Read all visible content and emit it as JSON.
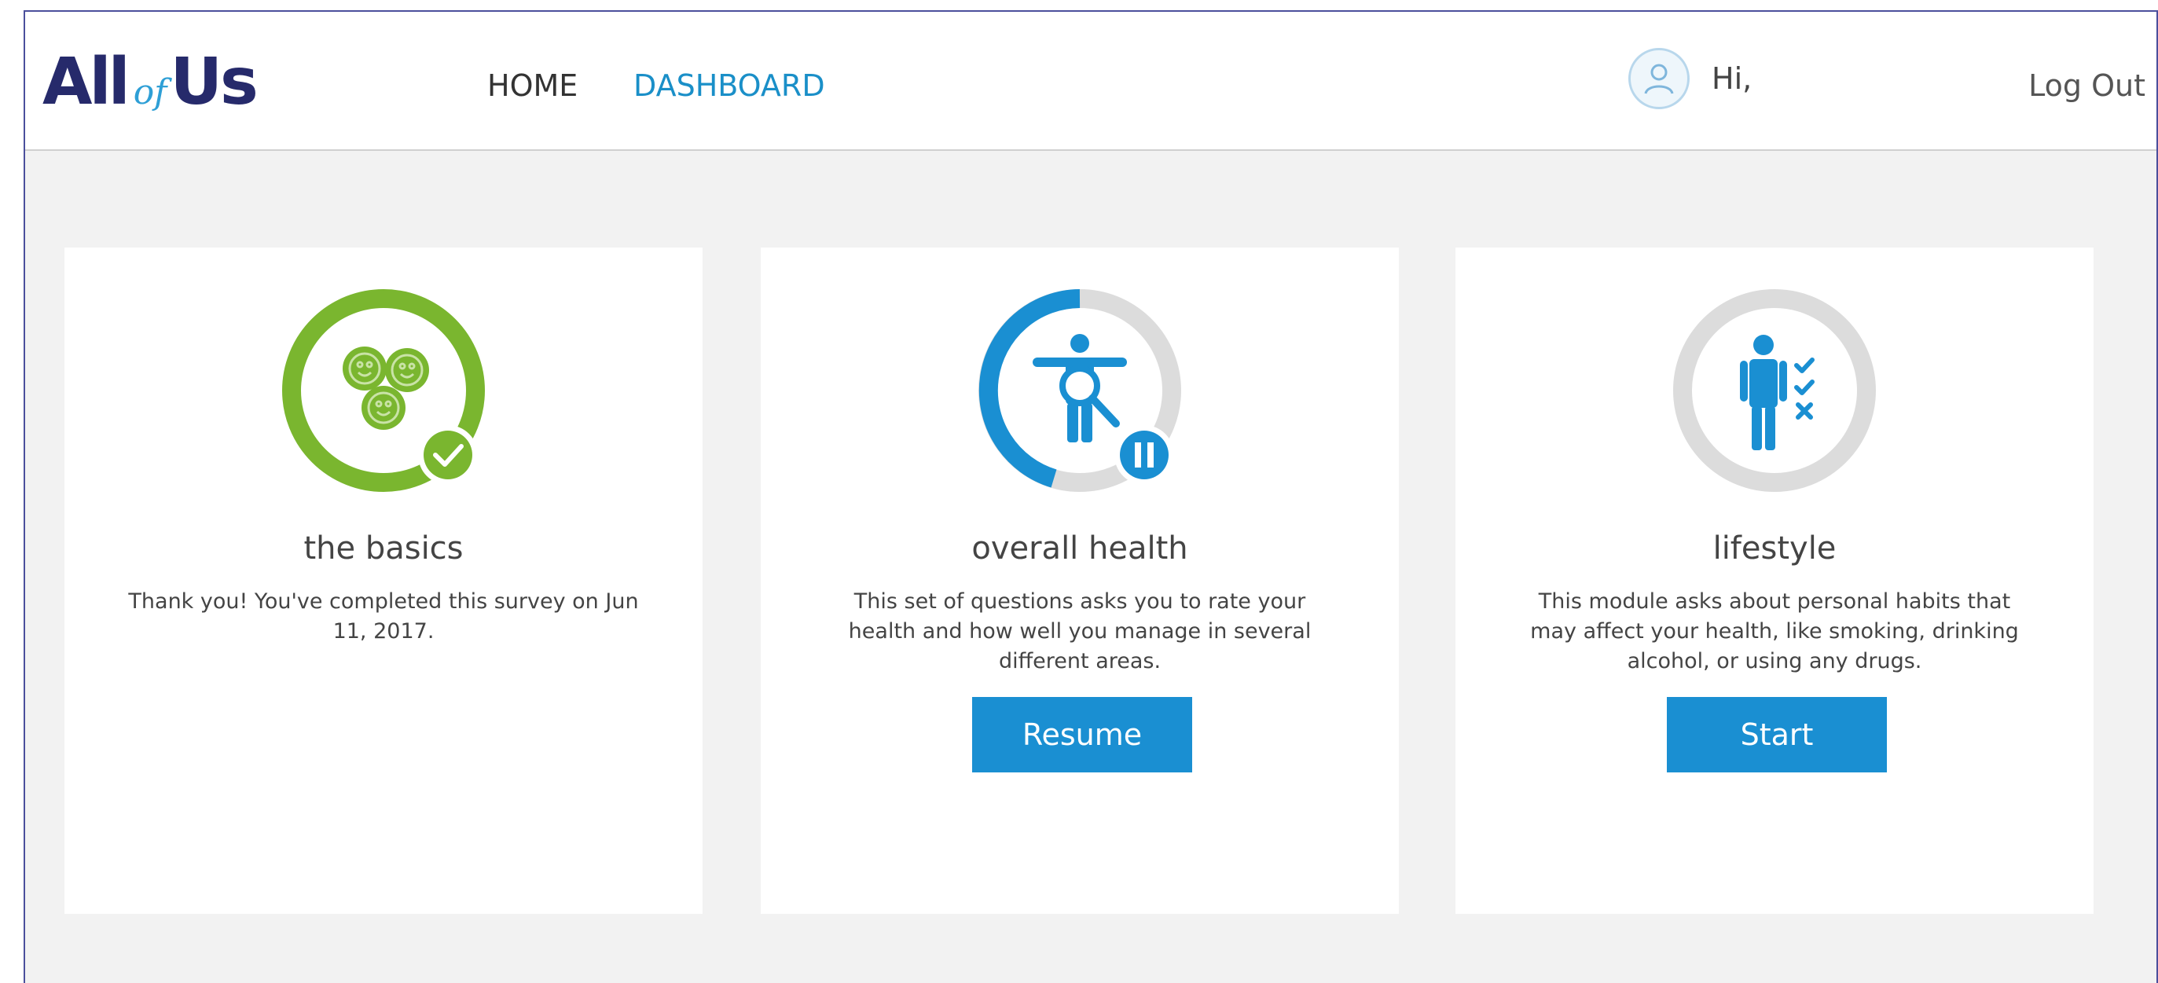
{
  "header": {
    "logo": {
      "part1": "All",
      "part2": "of",
      "part3": "Us"
    },
    "nav": {
      "home": "HOME",
      "dashboard": "DASHBOARD"
    },
    "greeting": "Hi,",
    "logout": "Log Out"
  },
  "colors": {
    "brand_navy": "#262a6b",
    "accent_blue": "#1a8fd2",
    "complete_green": "#7ab62f",
    "ring_gray": "#dcdcdc",
    "page_bg": "#f2f2f2"
  },
  "surveys": [
    {
      "title": "the basics",
      "description": "Thank you! You've completed this survey on Jun 11, 2017.",
      "status": "complete",
      "progress": 1.0,
      "icon": "smiley-faces-icon",
      "badge": "check-icon",
      "button": null
    },
    {
      "title": "overall health",
      "description": "This set of questions asks you to rate your health and how well you manage in several different areas.",
      "status": "in-progress",
      "progress": 0.45,
      "icon": "person-magnifier-icon",
      "badge": "pause-icon",
      "button": "Resume"
    },
    {
      "title": "lifestyle",
      "description": "This module asks about personal habits that may affect your health, like smoking, drinking alcohol, or using any drugs.",
      "status": "not-started",
      "progress": 0,
      "icon": "person-checklist-icon",
      "badge": null,
      "button": "Start"
    }
  ]
}
